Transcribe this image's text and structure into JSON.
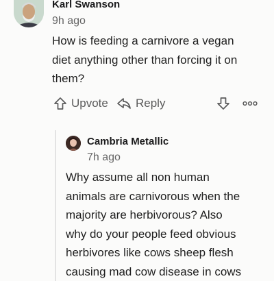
{
  "comment": {
    "author": "Karl Swanson",
    "time": "9h ago",
    "lines": [
      "How is feeding a carnivore a vegan",
      "diet anything other than forcing it on",
      "them?"
    ],
    "actions": {
      "upvote_label": "Upvote",
      "reply_label": "Reply"
    }
  },
  "reply": {
    "author": "Cambria Metallic",
    "time": "7h ago",
    "lines": [
      "Why assume all non human",
      "animals are carnivorous when the",
      "majority are herbivorous? Also",
      "why do your people feed obvious",
      "herbivores like cows sheep flesh",
      "causing mad cow disease in cows"
    ]
  },
  "icons": {
    "upvote": "arrow-up-outline-icon",
    "reply": "reply-arrow-icon",
    "downvote": "arrow-down-outline-icon",
    "more": "more-dots-icon"
  },
  "colors": {
    "background": "#fbfbfa",
    "text": "#1f1f1f",
    "muted": "#646464",
    "action": "#5a5a5a"
  }
}
